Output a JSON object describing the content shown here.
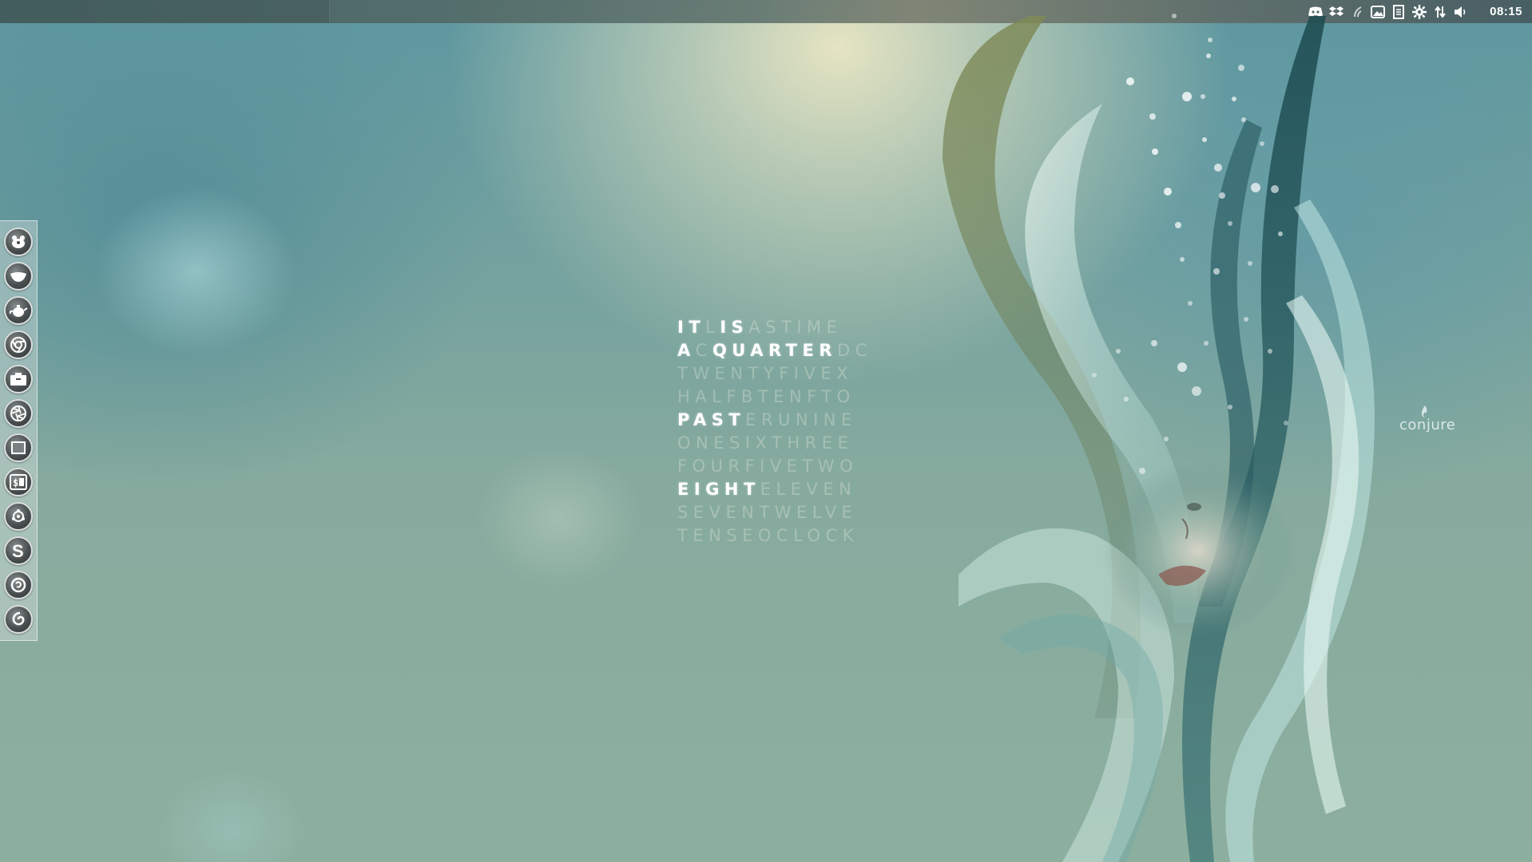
{
  "top_panel": {
    "tray_icons": [
      "discord-icon",
      "dropbox-icon",
      "network-signal-icon",
      "image-viewer-icon",
      "notes-icon",
      "settings-gear-icon",
      "network-transfer-icon",
      "volume-icon"
    ],
    "clock": "08:15"
  },
  "dock": {
    "items": [
      "gimp-icon",
      "mail-bird-icon",
      "teapot-icon",
      "chrome-icon",
      "files-icon",
      "aperture-icon",
      "window-icon",
      "terminal-icon",
      "settings-cog-icon",
      "skype-icon",
      "firefox-icon",
      "spiral-icon"
    ]
  },
  "word_clock": {
    "rows": [
      [
        {
          "t": "IT",
          "lit": true
        },
        {
          "t": "L",
          "lit": false
        },
        {
          "t": "IS",
          "lit": true
        },
        {
          "t": "ASTIME",
          "lit": false
        }
      ],
      [
        {
          "t": "A",
          "lit": true
        },
        {
          "t": "C",
          "lit": false
        },
        {
          "t": "QUARTER",
          "lit": true
        },
        {
          "t": "DC",
          "lit": false
        }
      ],
      [
        {
          "t": "TWENTYFIVEX",
          "lit": false
        }
      ],
      [
        {
          "t": "HALFBTENFTO",
          "lit": false
        }
      ],
      [
        {
          "t": "PAST",
          "lit": true
        },
        {
          "t": "ERUNINE",
          "lit": false
        }
      ],
      [
        {
          "t": "ONESIXTHREE",
          "lit": false
        }
      ],
      [
        {
          "t": "FOURFIVETWO",
          "lit": false
        }
      ],
      [
        {
          "t": "EIGHT",
          "lit": true
        },
        {
          "t": "ELEVEN",
          "lit": false
        }
      ],
      [
        {
          "t": "SEVENTWELVE",
          "lit": false
        }
      ],
      [
        {
          "t": "TENSEOCLOCK",
          "lit": false
        }
      ]
    ]
  },
  "wallpaper": {
    "watermark": "conjure",
    "colors": {
      "teal": "#4f8a96",
      "cream": "#ece8c4",
      "sage": "#8caf9f",
      "dark_teal": "#1f4d52"
    }
  }
}
